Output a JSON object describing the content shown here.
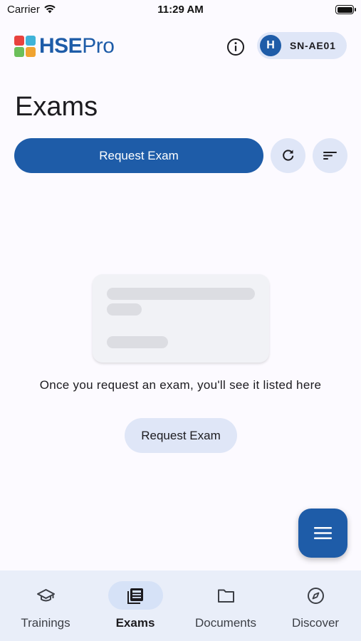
{
  "status_bar": {
    "carrier": "Carrier",
    "time": "11:29 AM"
  },
  "header": {
    "logo_bold": "HSE",
    "logo_light": "Pro",
    "logo_colors": [
      "#e8423e",
      "#3fb3d8",
      "#6cbf5a",
      "#f0a330"
    ],
    "account": {
      "initial": "H",
      "label": "SN-AE01"
    }
  },
  "page": {
    "title": "Exams"
  },
  "toolbar": {
    "request_label": "Request Exam"
  },
  "empty_state": {
    "message": "Once you request an exam, you'll see it listed here",
    "button_label": "Request Exam"
  },
  "nav": {
    "items": [
      {
        "label": "Trainings",
        "icon": "graduation-cap-icon",
        "active": false
      },
      {
        "label": "Exams",
        "icon": "newspaper-icon",
        "active": true
      },
      {
        "label": "Documents",
        "icon": "folder-icon",
        "active": false
      },
      {
        "label": "Discover",
        "icon": "compass-icon",
        "active": false
      }
    ]
  },
  "colors": {
    "primary": "#1e5ca8",
    "tonal": "#dfe6f7",
    "nav_background": "#e9eef9",
    "background": "#fcfaff"
  }
}
